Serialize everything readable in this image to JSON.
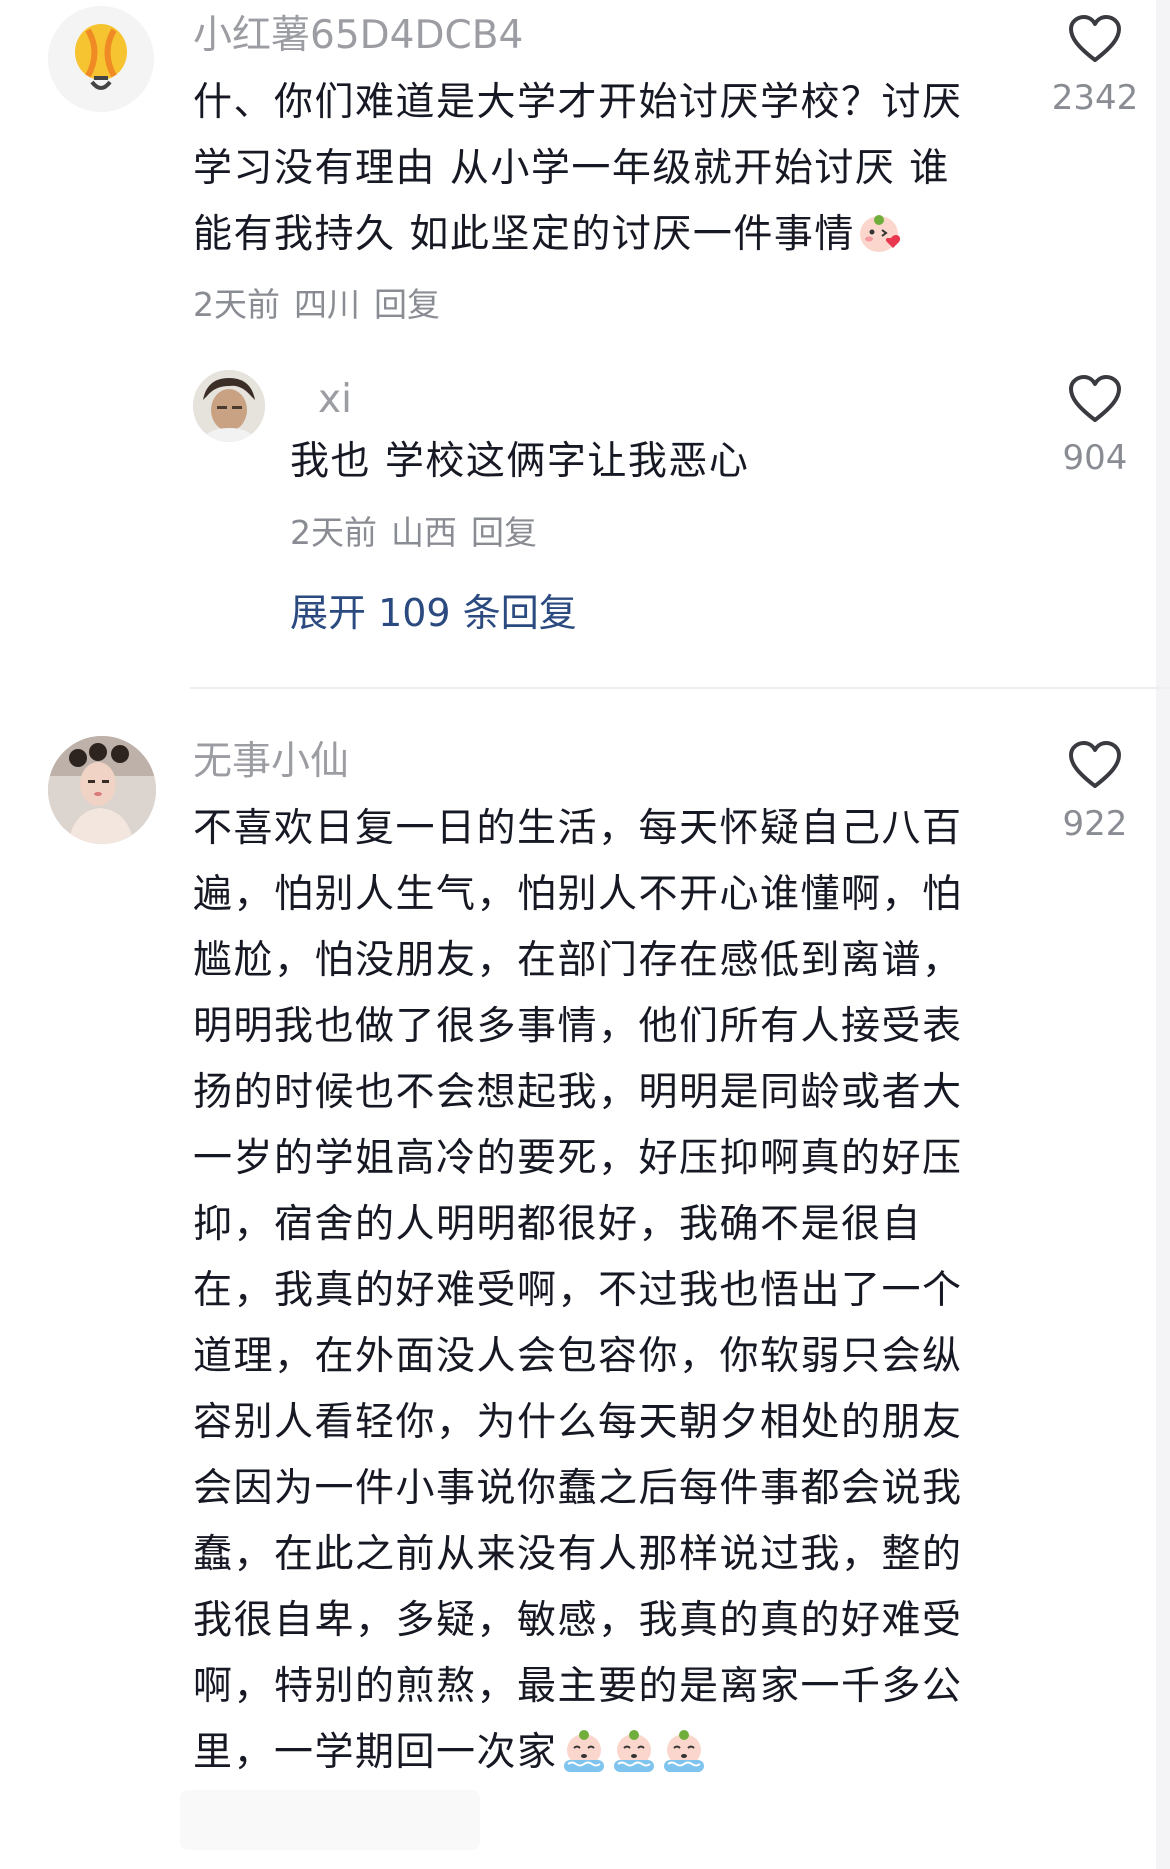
{
  "comments": [
    {
      "username": "小红薯65D4DCB4",
      "avatar_icon": "hot-air-balloon-icon",
      "lines": [
        "什、你们难道是大学才开始讨厌学校？讨厌",
        "学习没有理由 从小学一年级就开始讨厌 谁",
        "能有我持久 如此坚定的讨厌一件事情"
      ],
      "emoji": "kissing-face-emoji",
      "time": "2天前",
      "location": "四川",
      "reply_label": "回复",
      "likes": "2342",
      "replies": [
        {
          "username": "xi",
          "avatar_icon": "user-photo-avatar",
          "lines": [
            "我也 学校这俩字让我恶心"
          ],
          "time": "2天前",
          "location": "山西",
          "reply_label": "回复",
          "likes": "904"
        }
      ],
      "expand_label": "展开 109 条回复"
    },
    {
      "username": "无事小仙",
      "avatar_icon": "user-photo-avatar",
      "lines": [
        "不喜欢日复一日的生活，每天怀疑自己八百",
        "遍，怕别人生气，怕别人不开心谁懂啊，怕",
        "尴尬，怕没朋友，在部门存在感低到离谱，",
        "明明我也做了很多事情，他们所有人接受表",
        "扬的时候也不会想起我，明明是同龄或者大",
        "一岁的学姐高冷的要死，好压抑啊真的好压",
        "抑，宿舍的人明明都很好，我确不是很自",
        "在，我真的好难受啊，不过我也悟出了一个",
        "道理，在外面没人会包容你，你软弱只会纵",
        "容别人看轻你，为什么每天朝夕相处的朋友",
        "会因为一件小事说你蠢之后每件事都会说我",
        "蠢，在此之前从来没有人那样说过我，整的",
        "我很自卑，多疑，敏感，我真的真的好难受",
        "啊，特别的煎熬，最主要的是离家一千多公",
        "里，一学期回一次家"
      ],
      "emoji": "crying-face-emoji",
      "emoji_count": 3,
      "likes": "922"
    }
  ],
  "colors": {
    "text": "#161823",
    "muted": "#8a8c93",
    "link": "#2b4a80",
    "divider": "#eeeef0"
  }
}
